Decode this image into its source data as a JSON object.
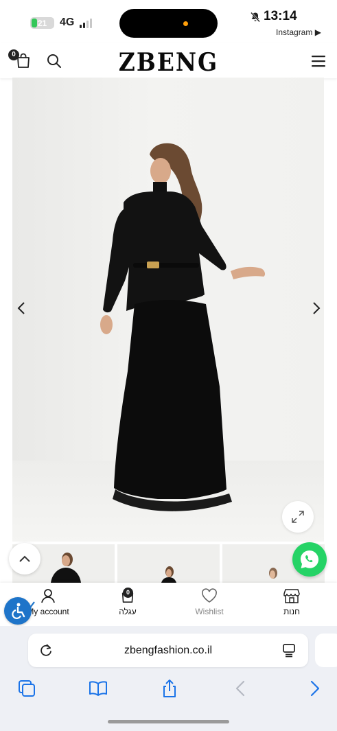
{
  "status_bar": {
    "battery_level": "21",
    "network": "4G",
    "time": "13:14",
    "back_app": "Instagram ▶",
    "battery_color": "#34c759",
    "island_indicator_color": "#ff9f0a"
  },
  "header": {
    "logo": "ZBENG",
    "cart_count": "0",
    "icons": [
      "cart-icon",
      "search-icon",
      "menu-icon"
    ]
  },
  "gallery": {
    "image_alt": "Model in long black dress with belted peplum top",
    "icons": [
      "arrow-left-icon",
      "arrow-right-icon",
      "expand-icon"
    ]
  },
  "bottom_nav": {
    "items": [
      {
        "label": "My account",
        "icon": "user-icon"
      },
      {
        "label": "עגלה",
        "icon": "cart-icon",
        "badge": "0"
      },
      {
        "label": "Wishlist",
        "icon": "heart-icon"
      },
      {
        "label": "חנות",
        "icon": "store-icon"
      }
    ]
  },
  "floating": {
    "icons": [
      "chevron-up-icon",
      "whatsapp-icon",
      "accessibility-icon"
    ],
    "whatsapp_color": "#25d366",
    "accessibility_color": "#1e74c9"
  },
  "browser": {
    "url": "zbengfashion.co.il",
    "accent_color": "#1a73e8",
    "toolbar_icons": [
      "tabs-icon",
      "bookmarks-icon",
      "share-icon",
      "back-icon",
      "forward-icon"
    ]
  }
}
